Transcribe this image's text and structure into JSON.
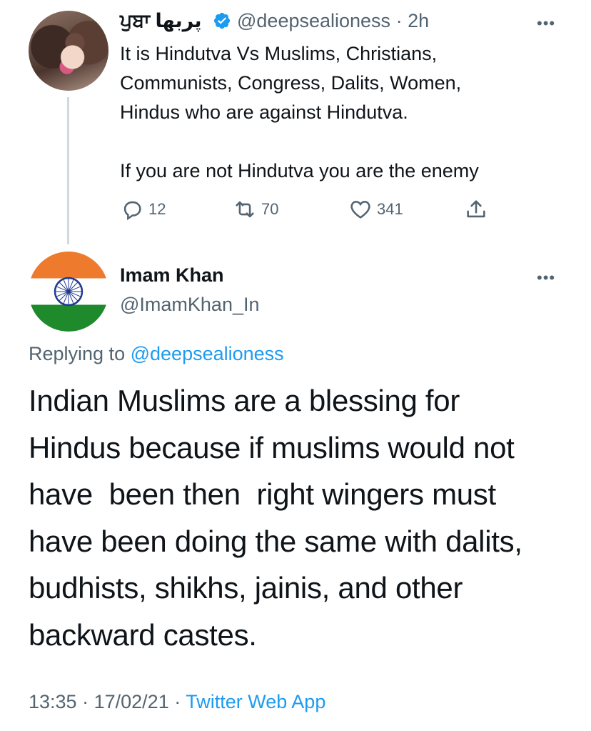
{
  "colors": {
    "accent": "#1d9bf0",
    "secondary_text": "#536471",
    "primary_text": "#0f1419"
  },
  "original_tweet": {
    "display_name": "ਪੁਬਾ پربھا",
    "verified_icon": "verified-badge-icon",
    "handle": "@deepsealioness",
    "separator": "·",
    "time": "2h",
    "more_icon": "more-dots-icon",
    "text": "It is Hindutva Vs Muslims, Christians,\nCommunists, Congress, Dalits, Women,\nHindus who are against Hindutva.\n\nIf you are not Hindutva you are the enemy",
    "actions": {
      "reply": {
        "icon": "reply-icon",
        "count": "12"
      },
      "retweet": {
        "icon": "retweet-icon",
        "count": "70"
      },
      "like": {
        "icon": "heart-icon",
        "count": "341"
      },
      "share": {
        "icon": "share-icon"
      }
    }
  },
  "reply_tweet": {
    "display_name": "Imam Khan",
    "handle": "@ImamKhan_In",
    "more_icon": "more-dots-icon",
    "replying_prefix": "Replying to",
    "replying_handle": "@deepsealioness",
    "text": "Indian Muslims are a blessing for\nHindus because if muslims would not\nhave  been then  right wingers must\nhave been doing the same with dalits,\nbudhists, shikhs, jainis, and other\nbackward castes.",
    "time": "13:35",
    "date": "17/02/21",
    "separator": "·",
    "source": "Twitter Web App"
  }
}
